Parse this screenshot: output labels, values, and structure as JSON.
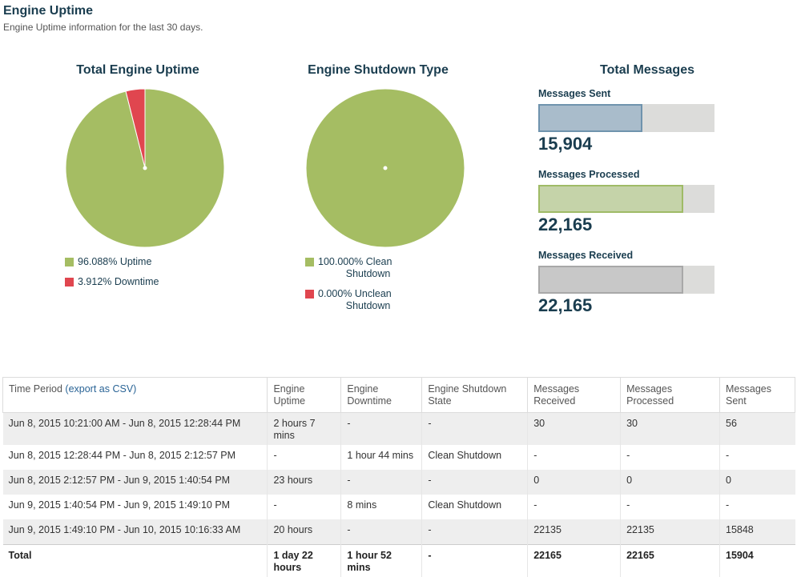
{
  "header": {
    "title": "Engine Uptime",
    "subtitle": "Engine Uptime information for the last 30 days."
  },
  "uptime_chart": {
    "title": "Total Engine Uptime",
    "slices": [
      {
        "label": "96.088% Uptime",
        "value": 96.088,
        "color": "#a5bd63"
      },
      {
        "label": "3.912% Downtime",
        "value": 3.912,
        "color": "#e0464f"
      }
    ]
  },
  "shutdown_chart": {
    "title": "Engine Shutdown Type",
    "slices": [
      {
        "label": "100.000% Clean\n          Shutdown",
        "value": 100.0,
        "color": "#a5bd63"
      },
      {
        "label": "0.000% Unclean\n          Shutdown",
        "value": 0.0,
        "color": "#e0464f"
      }
    ]
  },
  "messages": {
    "title": "Total Messages",
    "max": 27000,
    "items": [
      {
        "label": "Messages Sent",
        "value": 15904,
        "display": "15,904",
        "fill": "#a9bccb",
        "border": "#6f93ad"
      },
      {
        "label": "Messages Processed",
        "value": 22165,
        "display": "22,165",
        "fill": "#c5d3a9",
        "border": "#9fbb66"
      },
      {
        "label": "Messages Received",
        "value": 22165,
        "display": "22,165",
        "fill": "#c8c8c8",
        "border": "#a8a8a8"
      }
    ]
  },
  "table": {
    "time_period_header": "Time Period",
    "export_link": "(export as CSV)",
    "columns": [
      "Engine\nUptime",
      "Engine\nDowntime",
      "Engine Shutdown\nState",
      "Messages\nReceived",
      "Messages\nProcessed",
      "Messages\nSent"
    ],
    "rows": [
      [
        "Jun 8, 2015 10:21:00 AM - Jun 8, 2015 12:28:44 PM",
        "2 hours 7 mins",
        "-",
        "-",
        "30",
        "30",
        "56"
      ],
      [
        "Jun 8, 2015 12:28:44 PM - Jun 8, 2015 2:12:57 PM",
        "-",
        "1 hour 44 mins",
        "Clean Shutdown",
        "-",
        "-",
        "-"
      ],
      [
        "Jun 8, 2015 2:12:57 PM - Jun 9, 2015 1:40:54 PM",
        "23 hours",
        "-",
        "-",
        "0",
        "0",
        "0"
      ],
      [
        "Jun 9, 2015 1:40:54 PM - Jun 9, 2015 1:49:10 PM",
        "-",
        "8 mins",
        "Clean Shutdown",
        "-",
        "-",
        "-"
      ],
      [
        "Jun 9, 2015 1:49:10 PM - Jun 10, 2015 10:16:33 AM",
        "20 hours",
        "-",
        "-",
        "22135",
        "22135",
        "15848"
      ]
    ],
    "total": [
      "Total",
      "1 day 22 hours",
      "1 hour 52 mins",
      "-",
      "22165",
      "22165",
      "15904"
    ]
  }
}
